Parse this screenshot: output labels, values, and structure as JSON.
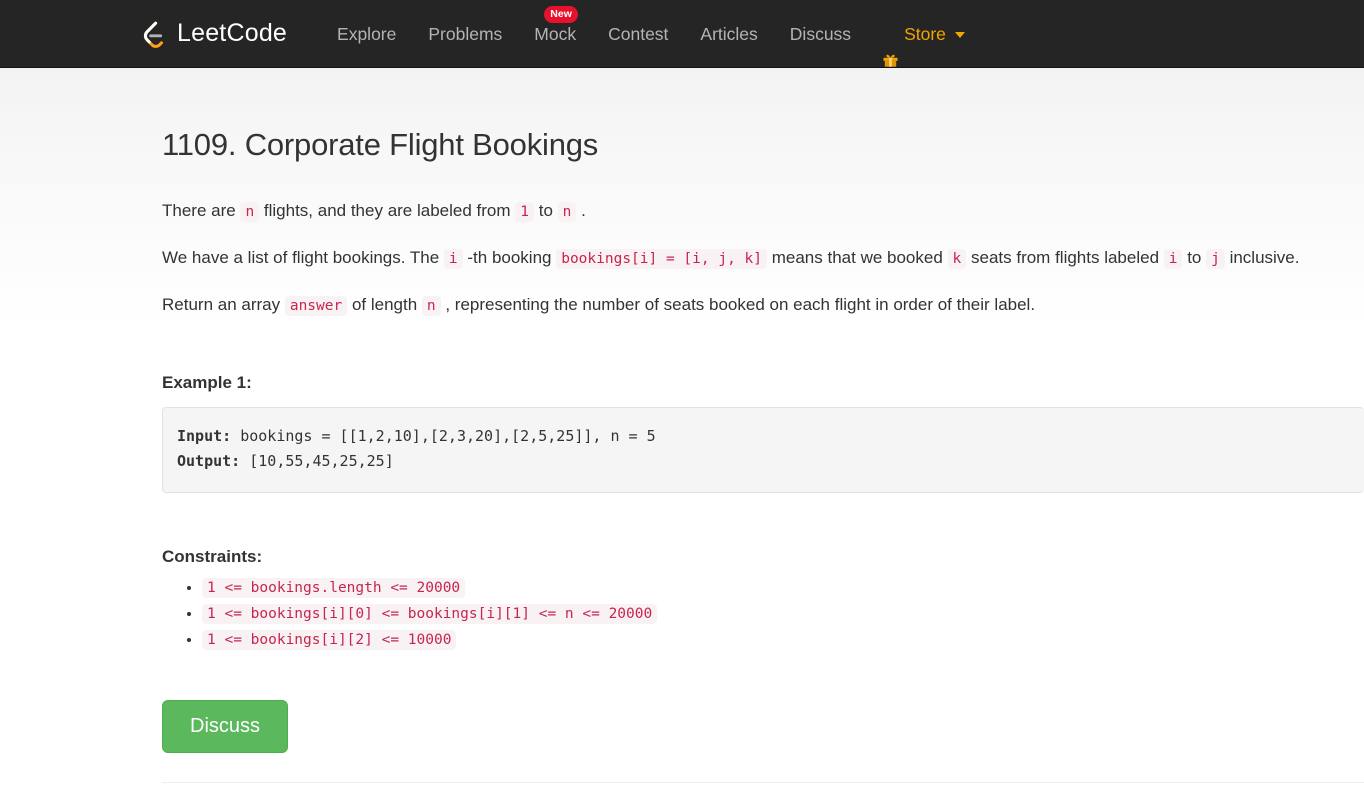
{
  "navbar": {
    "brand": "LeetCode",
    "brand_logo_icon": "leetcode-logo-icon",
    "links": [
      {
        "label": "Explore",
        "badge": null,
        "icon": null
      },
      {
        "label": "Problems",
        "badge": null,
        "icon": null
      },
      {
        "label": "Mock",
        "badge": "New",
        "icon": null
      },
      {
        "label": "Contest",
        "badge": null,
        "icon": null
      },
      {
        "label": "Articles",
        "badge": null,
        "icon": null
      },
      {
        "label": "Discuss",
        "badge": null,
        "icon": null
      },
      {
        "label": "Store",
        "badge": null,
        "icon": "gift-icon"
      }
    ],
    "store_caret_icon": "chevron-down-icon",
    "colors": {
      "background": "#252525",
      "link": "#b4b4b4",
      "store_accent": "#f0a500",
      "badge": "#e8112d"
    }
  },
  "problem": {
    "title": "1109. Corporate Flight Bookings",
    "paragraph1": {
      "t1": "There are ",
      "c1": "n",
      "t2": " flights, and they are labeled from ",
      "c2": "1",
      "t3": " to ",
      "c3": "n",
      "t4": " ."
    },
    "paragraph2": {
      "t1": "We have a list of flight bookings.  The ",
      "c1": "i",
      "t2": " -th booking ",
      "c2": "bookings[i] = [i, j, k]",
      "t3": " means that we booked ",
      "c3": "k",
      "t4": " seats from flights labeled ",
      "c4": "i",
      "t5": " to ",
      "c5": "j",
      "t6": " inclusive."
    },
    "paragraph3": {
      "t1": "Return an array ",
      "c1": "answer",
      "t2": " of length ",
      "c2": "n",
      "t3": " , representing the number of seats booked on each flight in order of their label."
    },
    "example_heading": "Example 1:",
    "example": {
      "input_label": "Input:",
      "input_value": " bookings = [[1,2,10],[2,3,20],[2,5,25]], n = 5",
      "output_label": "Output:",
      "output_value": " [10,55,45,25,25]"
    },
    "constraints_heading": "Constraints:",
    "constraints": [
      "1 <= bookings.length <= 20000",
      "1 <= bookings[i][0] <= bookings[i][1] <= n <= 20000",
      "1 <= bookings[i][2] <= 10000"
    ],
    "discuss_button": "Discuss",
    "colors": {
      "inline_code_text": "#c7254e",
      "inline_code_bg": "#f9f2f4",
      "code_block_bg": "#f5f5f5",
      "discuss_button_bg": "#5cb85c"
    }
  }
}
